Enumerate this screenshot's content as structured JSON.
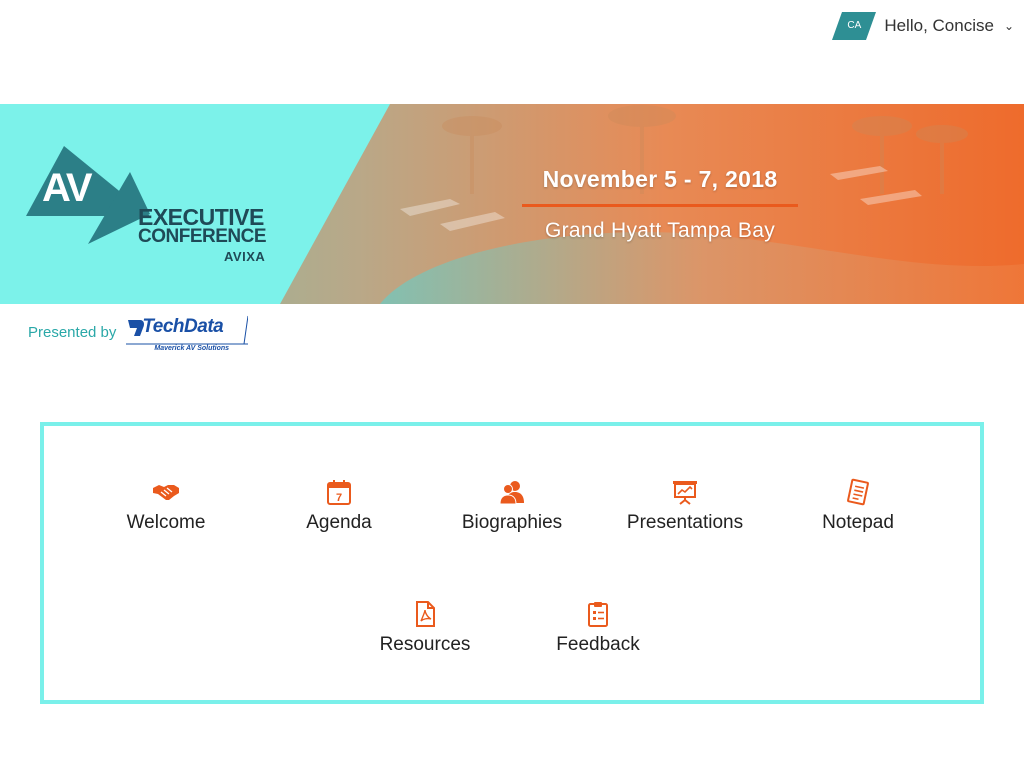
{
  "user": {
    "initials": "CA",
    "greeting": "Hello, Concise"
  },
  "banner": {
    "logo_letters": "AV",
    "logo_line1": "EXECUTIVE",
    "logo_line2": "CONFERENCE",
    "logo_org": "AVIXA",
    "date": "November 5 - 7, 2018",
    "venue": "Grand Hyatt Tampa Bay"
  },
  "sponsor": {
    "label": "Presented by",
    "name": "TechData",
    "tagline": "Maverick AV Solutions"
  },
  "nav": {
    "items": [
      {
        "label": "Welcome",
        "icon": "handshake-icon"
      },
      {
        "label": "Agenda",
        "icon": "calendar-icon"
      },
      {
        "label": "Biographies",
        "icon": "people-icon"
      },
      {
        "label": "Presentations",
        "icon": "presentation-board-icon"
      },
      {
        "label": "Notepad",
        "icon": "notepad-icon"
      },
      {
        "label": "Resources",
        "icon": "pdf-file-icon"
      },
      {
        "label": "Feedback",
        "icon": "clipboard-icon"
      }
    ]
  },
  "colors": {
    "accent": "#ea5a1d",
    "teal": "#7af0ea",
    "logo_dark": "#1f4a57",
    "sponsor_blue": "#1a50a6"
  }
}
